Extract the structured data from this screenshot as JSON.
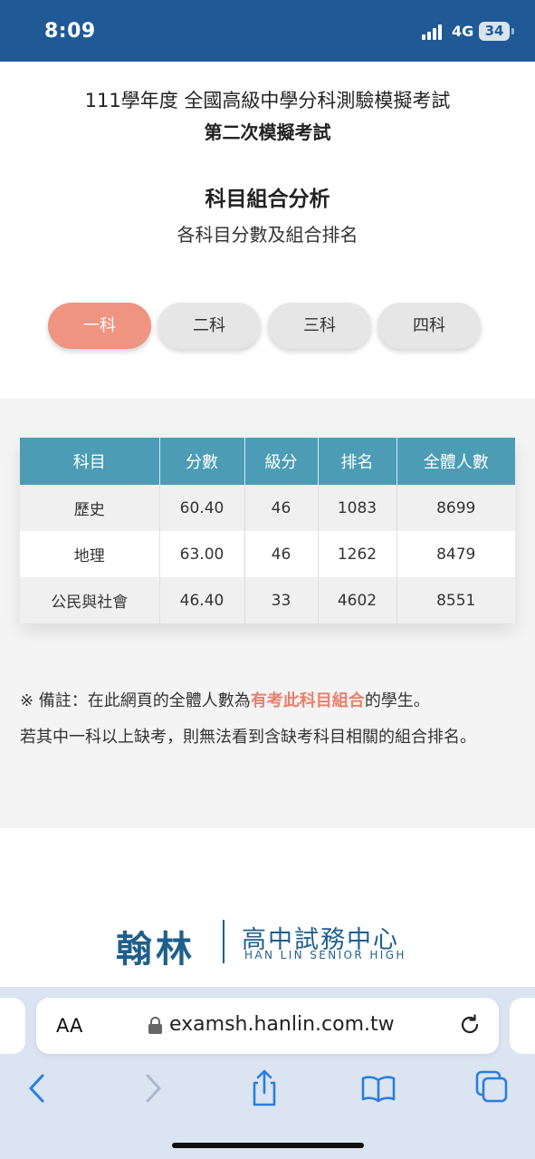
{
  "status_bar": {
    "time": "8:09",
    "network": "4G",
    "battery": "34"
  },
  "header": {
    "exam_title": "111學年度 全國高級中學分科測驗模擬考試",
    "exam_subtitle": "第二次模擬考試",
    "section_title": "科目組合分析",
    "section_subtitle": "各科目分數及組合排名"
  },
  "tabs": [
    {
      "label": "一科",
      "active": true
    },
    {
      "label": "二科",
      "active": false
    },
    {
      "label": "三科",
      "active": false
    },
    {
      "label": "四科",
      "active": false
    }
  ],
  "table": {
    "headers": [
      "科目",
      "分數",
      "級分",
      "排名",
      "全體人數"
    ],
    "rows": [
      [
        "歷史",
        "60.40",
        "46",
        "1083",
        "8699"
      ],
      [
        "地理",
        "63.00",
        "46",
        "1262",
        "8479"
      ],
      [
        "公民與社會",
        "46.40",
        "33",
        "4602",
        "8551"
      ]
    ]
  },
  "notes": {
    "note1_prefix": "※ 備註：在此網頁的全體人數為",
    "note1_highlight": "有考此科目組合",
    "note1_suffix": "的學生。",
    "note2": "若其中一科以上缺考，則無法看到含缺考科目相關的組合排名。"
  },
  "logo": {
    "main": "翰林",
    "cn": "高中試務中心",
    "en": "HAN LIN SENIOR HIGH"
  },
  "browser": {
    "aa_label": "AA",
    "url": "examsh.hanlin.com.tw"
  },
  "colors": {
    "status_bar": "#1f5a96",
    "accent": "#ee9480",
    "table_header": "#4b9cb4",
    "logo": "#1f5f8c",
    "highlight": "#e8806c"
  }
}
